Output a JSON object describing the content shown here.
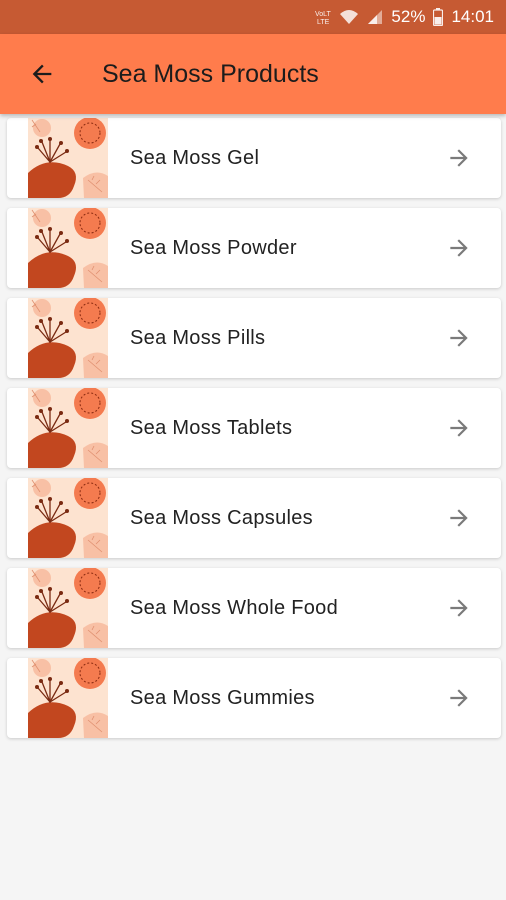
{
  "status_bar": {
    "battery_percent": "52%",
    "time": "14:01",
    "network_label": "LTE",
    "icons": [
      "volte-icon",
      "wifi-icon",
      "signal-icon",
      "battery-icon"
    ]
  },
  "app_bar": {
    "title": "Sea Moss Products",
    "background_color": "#ff7c4c",
    "back_icon": "arrow-left-icon"
  },
  "products": [
    {
      "label": "Sea Moss Gel"
    },
    {
      "label": "Sea Moss Powder"
    },
    {
      "label": "Sea Moss Pills"
    },
    {
      "label": "Sea Moss Tablets"
    },
    {
      "label": "Sea Moss Capsules"
    },
    {
      "label": "Sea Moss Whole Food"
    },
    {
      "label": "Sea Moss Gummies"
    }
  ],
  "item_icon": "arrow-right-icon",
  "thumbnail": "seaweed-illustration",
  "colors": {
    "status_bar": "#c65a33",
    "accent": "#ff7c4c",
    "thumb_dark": "#c2471f",
    "thumb_light": "#fde3d0"
  }
}
